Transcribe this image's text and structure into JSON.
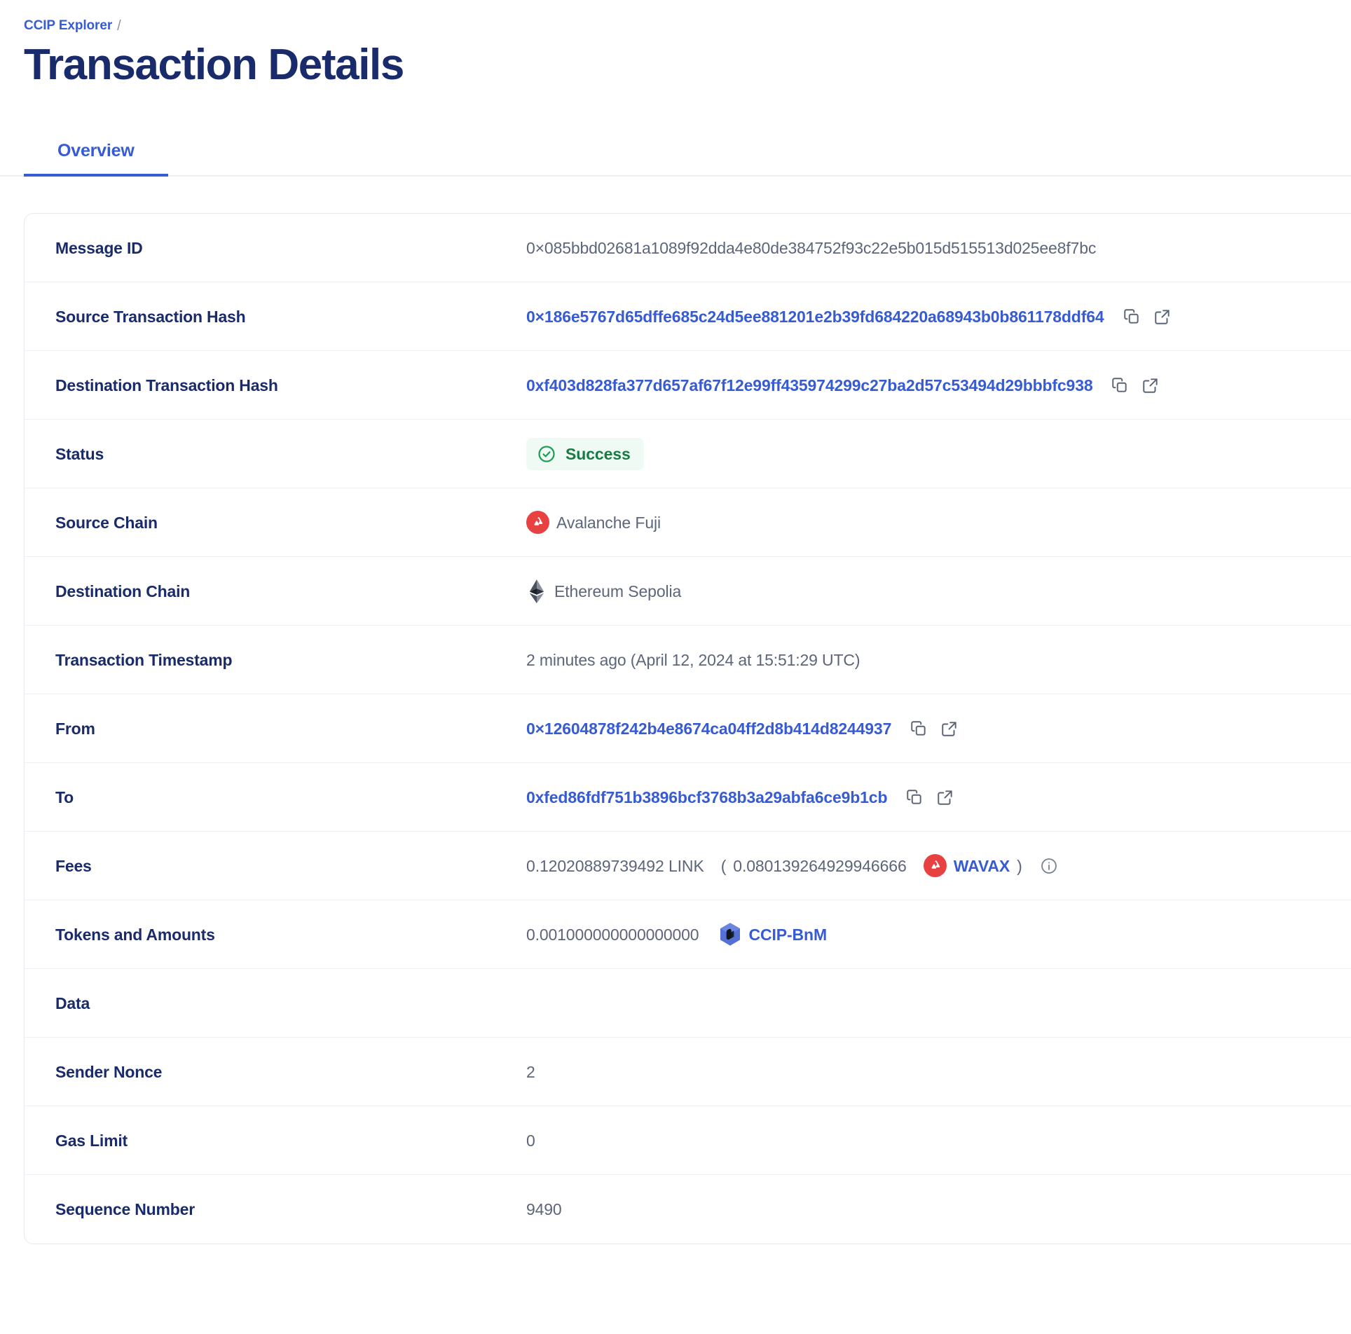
{
  "breadcrumb": {
    "parent": "CCIP Explorer",
    "separator": "/"
  },
  "page_title": "Transaction Details",
  "tabs": [
    {
      "label": "Overview",
      "active": true
    }
  ],
  "details": {
    "message_id": {
      "label": "Message ID",
      "value": "0×085bbd02681a1089f92dda4e80de384752f93c22e5b015d515513d025ee8f7bc"
    },
    "source_tx_hash": {
      "label": "Source Transaction Hash",
      "value": "0×186e5767d65dffe685c24d5ee881201e2b39fd684220a68943b0b861178ddf64"
    },
    "destination_tx_hash": {
      "label": "Destination Transaction Hash",
      "value": "0xf403d828fa377d657af67f12e99ff435974299c27ba2d57c53494d29bbbfc938"
    },
    "status": {
      "label": "Status",
      "value": "Success"
    },
    "source_chain": {
      "label": "Source Chain",
      "value": "Avalanche Fuji"
    },
    "destination_chain": {
      "label": "Destination Chain",
      "value": "Ethereum Sepolia"
    },
    "timestamp": {
      "label": "Transaction Timestamp",
      "value": "2 minutes ago (April 12, 2024 at 15:51:29 UTC)"
    },
    "from": {
      "label": "From",
      "value": "0×12604878f242b4e8674ca04ff2d8b414d8244937"
    },
    "to": {
      "label": "To",
      "value": "0xfed86fdf751b3896bcf3768b3a29abfa6ce9b1cb"
    },
    "fees": {
      "label": "Fees",
      "primary": "0.12020889739492 LINK",
      "paren_open": "(",
      "secondary_amount": "0.080139264929946666",
      "secondary_token": "WAVAX",
      "paren_close": ")"
    },
    "tokens_and_amounts": {
      "label": "Tokens and Amounts",
      "amount": "0.001000000000000000",
      "token": "CCIP-BnM"
    },
    "data": {
      "label": "Data",
      "value": ""
    },
    "sender_nonce": {
      "label": "Sender Nonce",
      "value": "2"
    },
    "gas_limit": {
      "label": "Gas Limit",
      "value": "0"
    },
    "sequence_number": {
      "label": "Sequence Number",
      "value": "9490"
    }
  },
  "icons": {
    "copy": "copy-icon",
    "external_link": "external-link-icon",
    "info": "info-icon",
    "success_check": "check-circle-icon",
    "avalanche": "avalanche-logo-icon",
    "ethereum": "ethereum-logo-icon",
    "ccip_bnm": "ccip-bnm-token-icon"
  },
  "colors": {
    "brand_blue": "#375bd2",
    "title_navy": "#1a2b6b",
    "success_green": "#1a7a46",
    "success_bg": "#eefaf3",
    "avalanche_red": "#e84142",
    "muted_text": "#5c6579"
  }
}
